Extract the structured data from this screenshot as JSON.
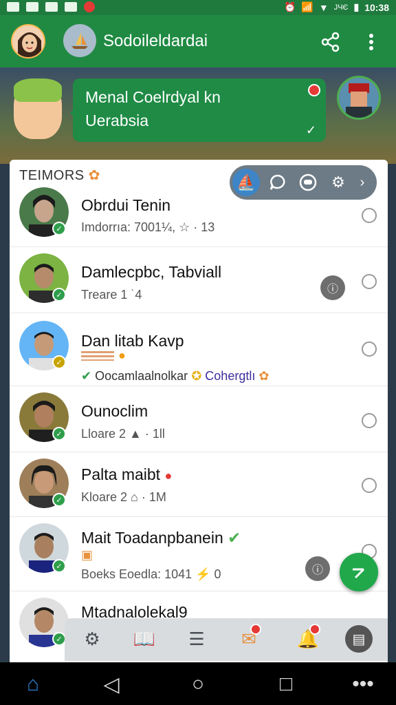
{
  "status_bar": {
    "signal_text": "JЧЄ",
    "time": "10:38"
  },
  "app_bar": {
    "title": "Sodoileldardai",
    "share_icon": "share-icon",
    "more_icon": "more-vert-icon"
  },
  "banner": {
    "line1": "Menal Coelrdyal kn",
    "line2": "Uerabsia",
    "tick": "✓"
  },
  "list_header": {
    "title": "TEIMORS",
    "badge_icon": "award-icon"
  },
  "toolbar_icons": [
    "sail-icon",
    "chat-icon",
    "account-icon",
    "gear-icon",
    "chevron-right-icon"
  ],
  "contacts": [
    {
      "name": "Obrdui Tenin",
      "sub": "Imdorrıa: 7001¼, ☆ · 13",
      "avatar_color": "#c7a58c",
      "badge": "green"
    },
    {
      "name": "Damlecpbc, Tabviall",
      "sub": "Treare 1 ˙4",
      "avatar_color": "#8d6e5a",
      "badge": "green"
    },
    {
      "name": "Dan litab Kavp",
      "sub": "Oocamlaalnolkar",
      "sub_link": "Cohergtlı",
      "avatar_color": "#b08a6d",
      "badge": "gold"
    },
    {
      "name": "Ounoclim",
      "sub": "Lloare 2 ▲ · 1ll",
      "avatar_color": "#7d5a45",
      "badge": "green"
    },
    {
      "name": "Palta maibt",
      "sub": "Kloare 2 ⌂ · 1M",
      "avatar_color": "#a77a5c",
      "badge": "green"
    },
    {
      "name": "Mait Toadanpbanein",
      "sub": "Boeks Eoedla: 1041 ⚡ 0",
      "avatar_color": "#6f4e3a",
      "badge": "green"
    },
    {
      "name": "Mtadnalolekal9",
      "sub": "",
      "avatar_color": "#8c6850",
      "badge": "green"
    }
  ],
  "bottom_tabs": [
    "gear-icon",
    "book-icon",
    "clipboard-icon",
    "mail-icon",
    "bell-icon",
    "sd-card-icon"
  ],
  "nav_bar": [
    "home-icon",
    "back-icon",
    "circle-home-icon",
    "recents-icon",
    "more-horiz-icon"
  ]
}
